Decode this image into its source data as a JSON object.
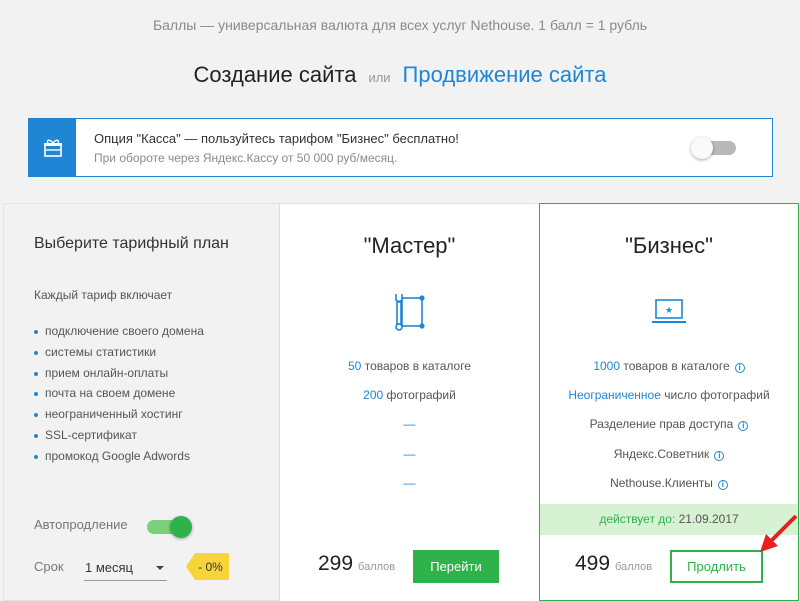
{
  "top_note": "Баллы — универсальная валюта для всех услуг Nethouse. 1 балл = 1 рубль",
  "switcher": {
    "current": "Создание сайта",
    "separator": "или",
    "alternative": "Продвижение сайта"
  },
  "banner": {
    "icon": "gift-box-icon",
    "title": "Опция \"Касса\" — пользуйтесь тарифом \"Бизнес\" бесплатно!",
    "subtitle": "При обороте через Яндекс.Кассу от 50 000 руб/месяц.",
    "toggle_on": false
  },
  "left": {
    "title": "Выберите тарифный план",
    "includes_label": "Каждый тариф включает",
    "includes": [
      "подключение своего домена",
      "системы статистики",
      "прием онлайн-оплаты",
      "почта на своем домене",
      "неограниченный хостинг",
      "SSL-сертификат",
      "промокод Google Adwords"
    ],
    "autorenew_label": "Автопродление",
    "autorenew_on": true,
    "term_label": "Срок",
    "term_value": "1 месяц",
    "discount": "- 0%"
  },
  "master": {
    "name": "\"Мастер\"",
    "icon": "tools-icon",
    "goods_count": "50",
    "goods_text": "товаров в каталоге",
    "photos_count": "200",
    "photos_text": "фотографий",
    "dash": "—",
    "price": "299",
    "price_unit": "баллов",
    "button": "Перейти"
  },
  "business": {
    "name": "\"Бизнес\"",
    "icon": "monitor-star-icon",
    "goods_count": "1000",
    "goods_text": "товаров в каталоге",
    "photos_highlight": "Неограниченное",
    "photos_text": "число фотографий",
    "access": "Разделение прав доступа",
    "advisor": "Яндекс.Советник",
    "clients": "Nethouse.Клиенты",
    "info_glyph": "i",
    "active_label": "действует до:",
    "active_date": "21.09.2017",
    "price": "499",
    "price_unit": "баллов",
    "button": "Продлить"
  },
  "colors": {
    "accent_blue": "#1f86d6",
    "accent_green": "#2db34a",
    "discount_yellow": "#f7d43a",
    "arrow_red": "#e8211d"
  }
}
